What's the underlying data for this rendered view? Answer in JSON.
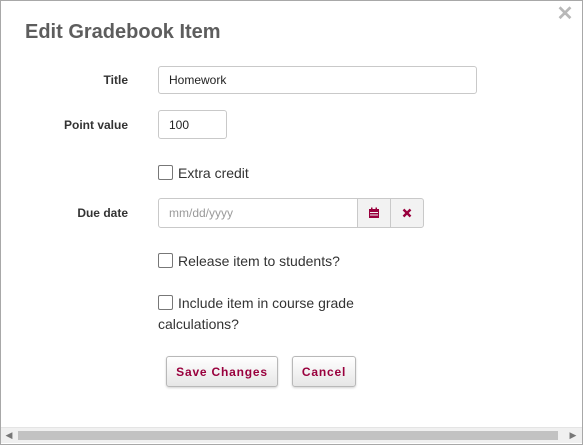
{
  "dialog": {
    "title": "Edit Gradebook Item",
    "close_icon": "close-icon"
  },
  "form": {
    "title_label": "Title",
    "title_value": "Homework",
    "point_label": "Point value",
    "point_value": "100",
    "extra_credit_label": "Extra credit",
    "due_label": "Due date",
    "due_placeholder": "mm/dd/yyyy",
    "calendar_icon": "calendar-icon",
    "clear_icon": "clear-x-icon",
    "release_label": "Release item to students?",
    "include_label_line1": "Include item in course grade",
    "include_label_line2": "calculations?"
  },
  "buttons": {
    "save_label": "Save Changes",
    "cancel_label": "Cancel"
  },
  "colors": {
    "accent": "#99003d",
    "title_text": "#5d5d5d"
  }
}
